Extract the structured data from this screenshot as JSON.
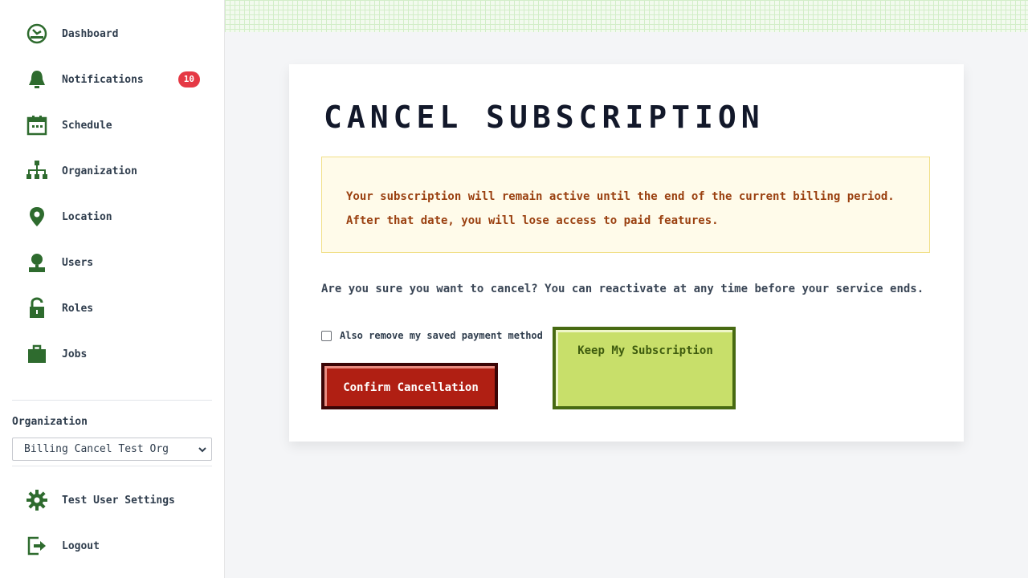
{
  "sidebar": {
    "items": [
      {
        "label": "Dashboard",
        "icon": "dashboard-icon"
      },
      {
        "label": "Notifications",
        "icon": "bell-icon",
        "badge": "10"
      },
      {
        "label": "Schedule",
        "icon": "calendar-icon"
      },
      {
        "label": "Organization",
        "icon": "org-chart-icon"
      },
      {
        "label": "Location",
        "icon": "location-pin-icon"
      },
      {
        "label": "Users",
        "icon": "user-icon"
      },
      {
        "label": "Roles",
        "icon": "lock-icon"
      },
      {
        "label": "Jobs",
        "icon": "briefcase-icon"
      }
    ],
    "org_label": "Organization",
    "org_selected": "Billing Cancel Test Org",
    "settings_label": "Test User Settings",
    "logout_label": "Logout"
  },
  "main": {
    "title": "CANCEL SUBSCRIPTION",
    "warning": "Your subscription will remain active until the end of the current billing period. After that date, you will lose access to paid features.",
    "question": "Are you sure you want to cancel? You can reactivate at any time before your service ends.",
    "checkbox_label": "Also remove my saved payment method",
    "confirm_label": "Confirm Cancellation",
    "keep_label": "Keep My Subscription"
  },
  "colors": {
    "icon_green": "#2e6b2e",
    "badge_red": "#e53945",
    "confirm_red": "#b01f13",
    "keep_green": "#c8df6a"
  }
}
